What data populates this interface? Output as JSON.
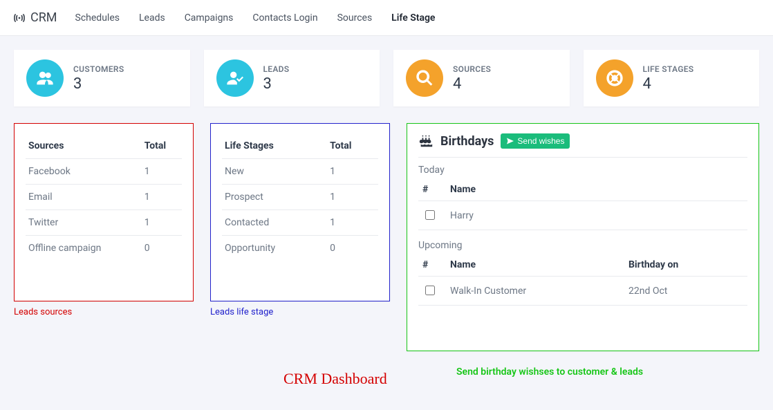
{
  "nav": {
    "brand": "CRM",
    "links": [
      {
        "label": "Schedules",
        "active": false
      },
      {
        "label": "Leads",
        "active": false
      },
      {
        "label": "Campaigns",
        "active": false
      },
      {
        "label": "Contacts Login",
        "active": false
      },
      {
        "label": "Sources",
        "active": false
      },
      {
        "label": "Life Stage",
        "active": true
      }
    ]
  },
  "stats": {
    "customers": {
      "title": "CUSTOMERS",
      "value": "3"
    },
    "leads": {
      "title": "LEADS",
      "value": "3"
    },
    "sources": {
      "title": "SOURCES",
      "value": "4"
    },
    "lifestages": {
      "title": "LIFE STAGES",
      "value": "4"
    }
  },
  "sourcesTable": {
    "head1": "Sources",
    "head2": "Total",
    "rows": [
      {
        "name": "Facebook",
        "count": "1"
      },
      {
        "name": "Email",
        "count": "1"
      },
      {
        "name": "Twitter",
        "count": "1"
      },
      {
        "name": "Offline campaign",
        "count": "0"
      }
    ],
    "caption": "Leads sources"
  },
  "stagesTable": {
    "head1": "Life Stages",
    "head2": "Total",
    "rows": [
      {
        "name": "New",
        "count": "1"
      },
      {
        "name": "Prospect",
        "count": "1"
      },
      {
        "name": "Contacted",
        "count": "1"
      },
      {
        "name": "Opportunity",
        "count": "0"
      }
    ],
    "caption": "Leads life stage"
  },
  "birthdays": {
    "title": "Birthdays",
    "sendLabel": "Send wishes",
    "todayLabel": "Today",
    "today": {
      "head1": "#",
      "head2": "Name",
      "rows": [
        {
          "name": "Harry"
        }
      ]
    },
    "upcomingLabel": "Upcoming",
    "upcoming": {
      "head1": "#",
      "head2": "Name",
      "head3": "Birthday on",
      "rows": [
        {
          "name": "Walk-In Customer",
          "date": "22nd Oct"
        }
      ]
    },
    "caption": "Send birthday wishses to customer & leads"
  },
  "pageTitle": "CRM  Dashboard"
}
